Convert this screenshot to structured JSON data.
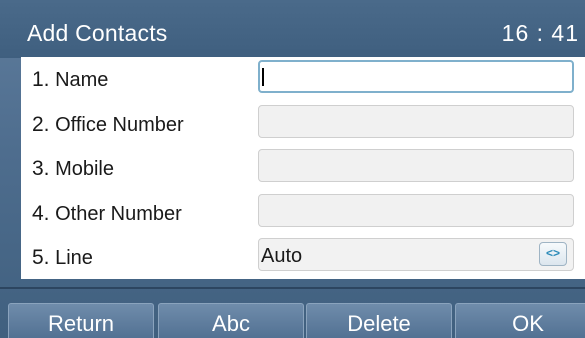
{
  "header": {
    "title": "Add Contacts",
    "clock": "16 : 41"
  },
  "form": {
    "fields": [
      {
        "number": "1.",
        "label": "Name",
        "value": "",
        "active": true
      },
      {
        "number": "2.",
        "label": "Office Number",
        "value": ""
      },
      {
        "number": "3.",
        "label": "Mobile",
        "value": ""
      },
      {
        "number": "4.",
        "label": "Other Number",
        "value": ""
      },
      {
        "number": "5.",
        "label": "Line",
        "value": "Auto",
        "switch_icon": "left-right-arrows-icon"
      }
    ]
  },
  "softkeys": [
    "Return",
    "Abc",
    "Delete",
    "OK"
  ],
  "colors": {
    "accent": "#2a8ab8",
    "title_bar": "#3f5f7f",
    "active_border": "#7fb0cc"
  }
}
